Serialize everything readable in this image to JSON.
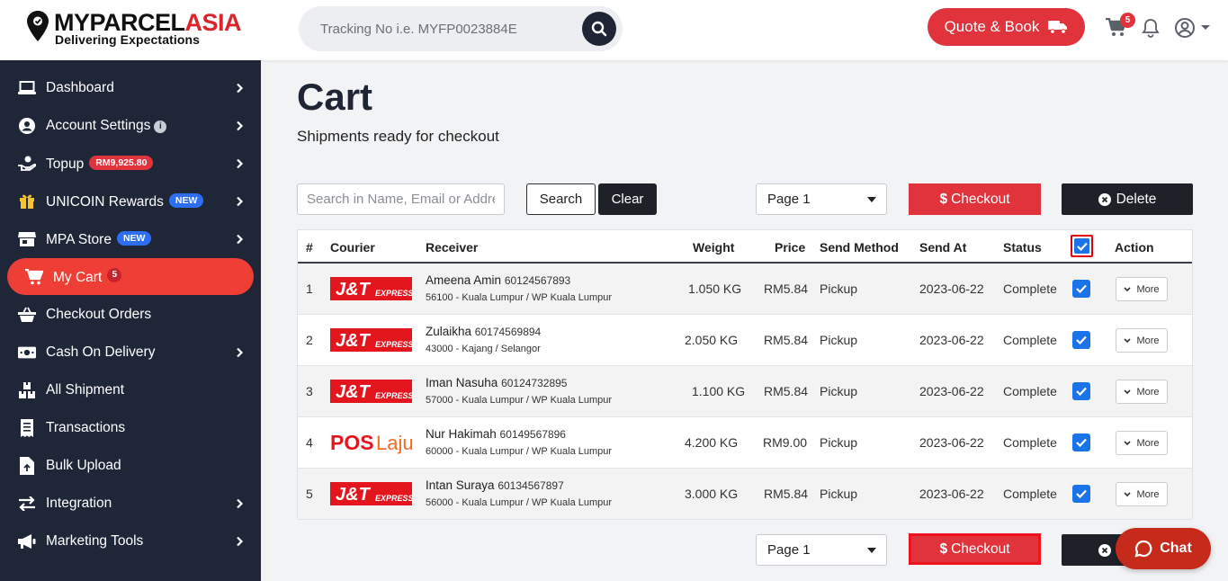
{
  "brand": {
    "name_part1": "MYPARCEL",
    "name_part2": "ASIA",
    "tagline": "Delivering Expectations"
  },
  "header": {
    "tracking_placeholder": "Tracking No i.e. MYFP0023884E",
    "quote_label": "Quote & Book",
    "cart_count": "5"
  },
  "sidebar": {
    "items": [
      {
        "label": "Dashboard",
        "icon": "laptop-icon"
      },
      {
        "label": "Account Settings",
        "icon": "user-circle-icon",
        "info": "i"
      },
      {
        "label": "Topup",
        "icon": "topup-hand-icon",
        "badge": "RM9,925.80"
      },
      {
        "label": "UNICOIN Rewards",
        "icon": "gift-icon",
        "badge": "NEW"
      },
      {
        "label": "MPA Store",
        "icon": "store-icon",
        "badge": "NEW"
      },
      {
        "label": "My Cart",
        "icon": "cart-icon",
        "badge": "5"
      },
      {
        "label": "Checkout Orders",
        "icon": "basket-icon"
      },
      {
        "label": "Cash On Delivery",
        "icon": "money-icon"
      },
      {
        "label": "All Shipment",
        "icon": "boxes-icon"
      },
      {
        "label": "Transactions",
        "icon": "receipt-icon"
      },
      {
        "label": "Bulk Upload",
        "icon": "file-upload-icon"
      },
      {
        "label": "Integration",
        "icon": "exchange-icon"
      },
      {
        "label": "Marketing Tools",
        "icon": "megaphone-icon"
      }
    ]
  },
  "page": {
    "title": "Cart",
    "subtitle": "Shipments ready for checkout"
  },
  "toolbar": {
    "search_placeholder": "Search in Name, Email or Address",
    "search_label": "Search",
    "clear_label": "Clear",
    "page_select": "Page 1",
    "checkout_label": "Checkout",
    "delete_label": "Delete"
  },
  "table": {
    "headers": [
      "#",
      "Courier",
      "Receiver",
      "Weight",
      "Price",
      "Send Method",
      "Send At",
      "Status",
      "Action"
    ],
    "more_label": "More",
    "rows": [
      {
        "num": "1",
        "courier": "J&T Express",
        "logo": "jt",
        "name": "Ameena Amin",
        "phone": "60124567893",
        "address": "56100 - Kuala Lumpur / WP Kuala Lumpur",
        "weight": "1.050 KG",
        "price": "RM5.84",
        "method": "Pickup",
        "date": "2023-06-22",
        "status": "Complete"
      },
      {
        "num": "2",
        "courier": "J&T Express",
        "logo": "jt",
        "name": "Zulaikha",
        "phone": "60174569894",
        "address": "43000 - Kajang / Selangor",
        "weight": "2.050 KG",
        "price": "RM5.84",
        "method": "Pickup",
        "date": "2023-06-22",
        "status": "Complete"
      },
      {
        "num": "3",
        "courier": "J&T Express",
        "logo": "jt",
        "name": "Iman Nasuha",
        "phone": "60124732895",
        "address": "57000 - Kuala Lumpur / WP Kuala Lumpur",
        "weight": "1.100 KG",
        "price": "RM5.84",
        "method": "Pickup",
        "date": "2023-06-22",
        "status": "Complete"
      },
      {
        "num": "4",
        "courier": "POS Laju",
        "logo": "pos",
        "name": "Nur Hakimah",
        "phone": "60149567896",
        "address": "60000 - Kuala Lumpur / WP Kuala Lumpur",
        "weight": "4.200 KG",
        "price": "RM9.00",
        "method": "Pickup",
        "date": "2023-06-22",
        "status": "Complete"
      },
      {
        "num": "5",
        "courier": "J&T Express",
        "logo": "jt",
        "name": "Intan Suraya",
        "phone": "60134567897",
        "address": "56000 - Kuala Lumpur / WP Kuala Lumpur",
        "weight": "3.000 KG",
        "price": "RM5.84",
        "method": "Pickup",
        "date": "2023-06-22",
        "status": "Complete"
      }
    ]
  },
  "chat": {
    "label": "Chat"
  },
  "colors": {
    "accent": "#e1333c",
    "sidebar_bg": "#1e2638",
    "dark_button": "#1e2128",
    "checkbox": "#1a73e8"
  }
}
